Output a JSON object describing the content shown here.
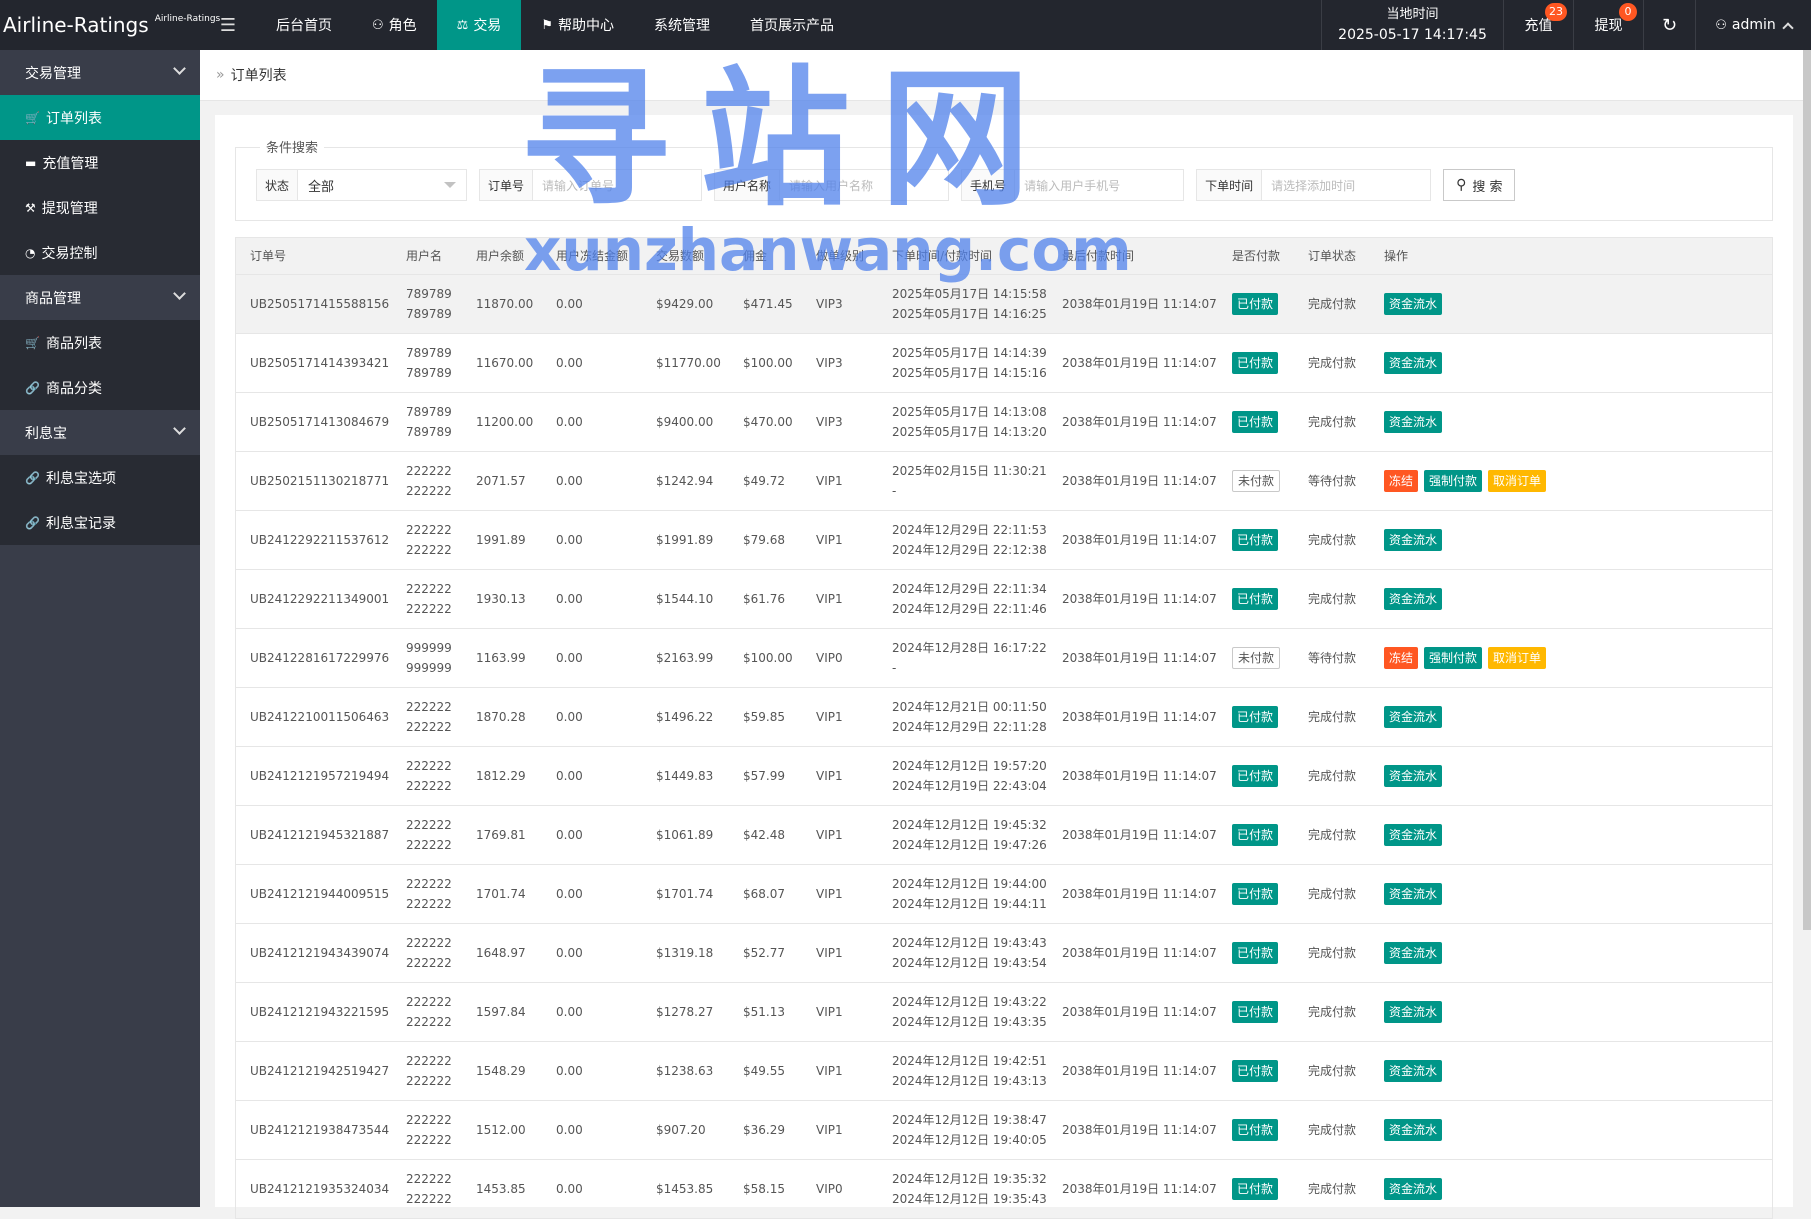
{
  "app": {
    "logo_main": "Airline-Ratings",
    "logo_sub": "Airline-Ratings"
  },
  "topnav": {
    "items": [
      {
        "label": "后台首页",
        "icon": ""
      },
      {
        "label": "角色",
        "icon": "user-icon"
      },
      {
        "label": "交易",
        "icon": "scale-icon"
      },
      {
        "label": "帮助中心",
        "icon": "flag-icon"
      },
      {
        "label": "系统管理",
        "icon": ""
      },
      {
        "label": "首页展示产品",
        "icon": ""
      }
    ],
    "active_index": 2
  },
  "header_right": {
    "clock_label": "当地时间",
    "clock_value": "2025-05-17 14:17:45",
    "recharge_label": "充值",
    "recharge_badge": "23",
    "withdraw_label": "提现",
    "withdraw_badge": "0",
    "user_label": "admin"
  },
  "sidebar": {
    "groups": [
      {
        "label": "交易管理",
        "items": [
          {
            "label": "订单列表",
            "icon": "cart-icon",
            "active": true
          },
          {
            "label": "充值管理",
            "icon": "monitor-icon",
            "active": false
          },
          {
            "label": "提现管理",
            "icon": "hammer-icon",
            "active": false
          },
          {
            "label": "交易控制",
            "icon": "dashboard-icon",
            "active": false
          }
        ]
      },
      {
        "label": "商品管理",
        "items": [
          {
            "label": "商品列表",
            "icon": "cart-icon",
            "active": false
          },
          {
            "label": "商品分类",
            "icon": "link-icon",
            "active": false
          }
        ]
      },
      {
        "label": "利息宝",
        "items": [
          {
            "label": "利息宝选项",
            "icon": "link-icon",
            "active": false
          },
          {
            "label": "利息宝记录",
            "icon": "link-icon",
            "active": false
          }
        ]
      }
    ]
  },
  "breadcrumb": {
    "label": "订单列表"
  },
  "search": {
    "legend": "条件搜索",
    "status_label": "状态",
    "status_value": "全部",
    "order_label": "订单号",
    "order_placeholder": "请输入订单号",
    "username_label": "用户名称",
    "username_placeholder": "请输入用户名称",
    "phone_label": "手机号",
    "phone_placeholder": "请输入用户手机号",
    "time_label": "下单时间",
    "time_placeholder": "请选择添加时间",
    "button_label": "搜 索"
  },
  "table": {
    "headers": [
      "订单号",
      "用户名",
      "用户余额",
      "用户冻结金额",
      "交易数额",
      "佣金",
      "做单级别",
      "下单时间/付款时间",
      "最后付款时间",
      "是否付款",
      "订单状态",
      "操作"
    ],
    "rows": [
      {
        "order": "UB2505171415588156",
        "user1": "789789",
        "user2": "789789",
        "balance": "11870.00",
        "frozen": "0.00",
        "amount": "$9429.00",
        "commission": "$471.45",
        "level": "VIP3",
        "t1": "2025年05月17日 14:15:58",
        "t2": "2025年05月17日 14:16:25",
        "last": "2038年01月19日 11:14:07",
        "paid": "已付款",
        "status": "完成付款",
        "actions": [
          "资金流水"
        ]
      },
      {
        "order": "UB2505171414393421",
        "user1": "789789",
        "user2": "789789",
        "balance": "11670.00",
        "frozen": "0.00",
        "amount": "$11770.00",
        "commission": "$100.00",
        "level": "VIP3",
        "t1": "2025年05月17日 14:14:39",
        "t2": "2025年05月17日 14:15:16",
        "last": "2038年01月19日 11:14:07",
        "paid": "已付款",
        "status": "完成付款",
        "actions": [
          "资金流水"
        ]
      },
      {
        "order": "UB2505171413084679",
        "user1": "789789",
        "user2": "789789",
        "balance": "11200.00",
        "frozen": "0.00",
        "amount": "$9400.00",
        "commission": "$470.00",
        "level": "VIP3",
        "t1": "2025年05月17日 14:13:08",
        "t2": "2025年05月17日 14:13:20",
        "last": "2038年01月19日 11:14:07",
        "paid": "已付款",
        "status": "完成付款",
        "actions": [
          "资金流水"
        ]
      },
      {
        "order": "UB2502151130218771",
        "user1": "222222",
        "user2": "222222",
        "balance": "2071.57",
        "frozen": "0.00",
        "amount": "$1242.94",
        "commission": "$49.72",
        "level": "VIP1",
        "t1": "2025年02月15日 11:30:21",
        "t2": "-",
        "last": "2038年01月19日 11:14:07",
        "paid": "未付款",
        "status": "等待付款",
        "actions": [
          "冻结",
          "强制付款",
          "取消订单"
        ]
      },
      {
        "order": "UB2412292211537612",
        "user1": "222222",
        "user2": "222222",
        "balance": "1991.89",
        "frozen": "0.00",
        "amount": "$1991.89",
        "commission": "$79.68",
        "level": "VIP1",
        "t1": "2024年12月29日 22:11:53",
        "t2": "2024年12月29日 22:12:38",
        "last": "2038年01月19日 11:14:07",
        "paid": "已付款",
        "status": "完成付款",
        "actions": [
          "资金流水"
        ]
      },
      {
        "order": "UB2412292211349001",
        "user1": "222222",
        "user2": "222222",
        "balance": "1930.13",
        "frozen": "0.00",
        "amount": "$1544.10",
        "commission": "$61.76",
        "level": "VIP1",
        "t1": "2024年12月29日 22:11:34",
        "t2": "2024年12月29日 22:11:46",
        "last": "2038年01月19日 11:14:07",
        "paid": "已付款",
        "status": "完成付款",
        "actions": [
          "资金流水"
        ]
      },
      {
        "order": "UB2412281617229976",
        "user1": "999999",
        "user2": "999999",
        "balance": "1163.99",
        "frozen": "0.00",
        "amount": "$2163.99",
        "commission": "$100.00",
        "level": "VIP0",
        "t1": "2024年12月28日 16:17:22",
        "t2": "-",
        "last": "2038年01月19日 11:14:07",
        "paid": "未付款",
        "status": "等待付款",
        "actions": [
          "冻结",
          "强制付款",
          "取消订单"
        ]
      },
      {
        "order": "UB2412210011506463",
        "user1": "222222",
        "user2": "222222",
        "balance": "1870.28",
        "frozen": "0.00",
        "amount": "$1496.22",
        "commission": "$59.85",
        "level": "VIP1",
        "t1": "2024年12月21日 00:11:50",
        "t2": "2024年12月29日 22:11:28",
        "last": "2038年01月19日 11:14:07",
        "paid": "已付款",
        "status": "完成付款",
        "actions": [
          "资金流水"
        ]
      },
      {
        "order": "UB2412121957219494",
        "user1": "222222",
        "user2": "222222",
        "balance": "1812.29",
        "frozen": "0.00",
        "amount": "$1449.83",
        "commission": "$57.99",
        "level": "VIP1",
        "t1": "2024年12月12日 19:57:20",
        "t2": "2024年12月19日 22:43:04",
        "last": "2038年01月19日 11:14:07",
        "paid": "已付款",
        "status": "完成付款",
        "actions": [
          "资金流水"
        ]
      },
      {
        "order": "UB2412121945321887",
        "user1": "222222",
        "user2": "222222",
        "balance": "1769.81",
        "frozen": "0.00",
        "amount": "$1061.89",
        "commission": "$42.48",
        "level": "VIP1",
        "t1": "2024年12月12日 19:45:32",
        "t2": "2024年12月12日 19:47:26",
        "last": "2038年01月19日 11:14:07",
        "paid": "已付款",
        "status": "完成付款",
        "actions": [
          "资金流水"
        ]
      },
      {
        "order": "UB2412121944009515",
        "user1": "222222",
        "user2": "222222",
        "balance": "1701.74",
        "frozen": "0.00",
        "amount": "$1701.74",
        "commission": "$68.07",
        "level": "VIP1",
        "t1": "2024年12月12日 19:44:00",
        "t2": "2024年12月12日 19:44:11",
        "last": "2038年01月19日 11:14:07",
        "paid": "已付款",
        "status": "完成付款",
        "actions": [
          "资金流水"
        ]
      },
      {
        "order": "UB2412121943439074",
        "user1": "222222",
        "user2": "222222",
        "balance": "1648.97",
        "frozen": "0.00",
        "amount": "$1319.18",
        "commission": "$52.77",
        "level": "VIP1",
        "t1": "2024年12月12日 19:43:43",
        "t2": "2024年12月12日 19:43:54",
        "last": "2038年01月19日 11:14:07",
        "paid": "已付款",
        "status": "完成付款",
        "actions": [
          "资金流水"
        ]
      },
      {
        "order": "UB2412121943221595",
        "user1": "222222",
        "user2": "222222",
        "balance": "1597.84",
        "frozen": "0.00",
        "amount": "$1278.27",
        "commission": "$51.13",
        "level": "VIP1",
        "t1": "2024年12月12日 19:43:22",
        "t2": "2024年12月12日 19:43:35",
        "last": "2038年01月19日 11:14:07",
        "paid": "已付款",
        "status": "完成付款",
        "actions": [
          "资金流水"
        ]
      },
      {
        "order": "UB2412121942519427",
        "user1": "222222",
        "user2": "222222",
        "balance": "1548.29",
        "frozen": "0.00",
        "amount": "$1238.63",
        "commission": "$49.55",
        "level": "VIP1",
        "t1": "2024年12月12日 19:42:51",
        "t2": "2024年12月12日 19:43:13",
        "last": "2038年01月19日 11:14:07",
        "paid": "已付款",
        "status": "完成付款",
        "actions": [
          "资金流水"
        ]
      },
      {
        "order": "UB2412121938473544",
        "user1": "222222",
        "user2": "222222",
        "balance": "1512.00",
        "frozen": "0.00",
        "amount": "$907.20",
        "commission": "$36.29",
        "level": "VIP1",
        "t1": "2024年12月12日 19:38:47",
        "t2": "2024年12月12日 19:40:05",
        "last": "2038年01月19日 11:14:07",
        "paid": "已付款",
        "status": "完成付款",
        "actions": [
          "资金流水"
        ]
      },
      {
        "order": "UB2412121935324034",
        "user1": "222222",
        "user2": "222222",
        "balance": "1453.85",
        "frozen": "0.00",
        "amount": "$1453.85",
        "commission": "$58.15",
        "level": "VIP0",
        "t1": "2024年12月12日 19:35:32",
        "t2": "2024年12月12日 19:35:43",
        "last": "2038年01月19日 11:14:07",
        "paid": "已付款",
        "status": "完成付款",
        "actions": [
          "资金流水"
        ]
      }
    ]
  },
  "watermark": {
    "cn": "寻站网",
    "en": "xunzhanwang.com"
  },
  "colors": {
    "accent": "#009688",
    "topbar": "#23262e",
    "sidebar": "#393d49",
    "danger": "#ff5722",
    "warning": "#ffb800"
  }
}
